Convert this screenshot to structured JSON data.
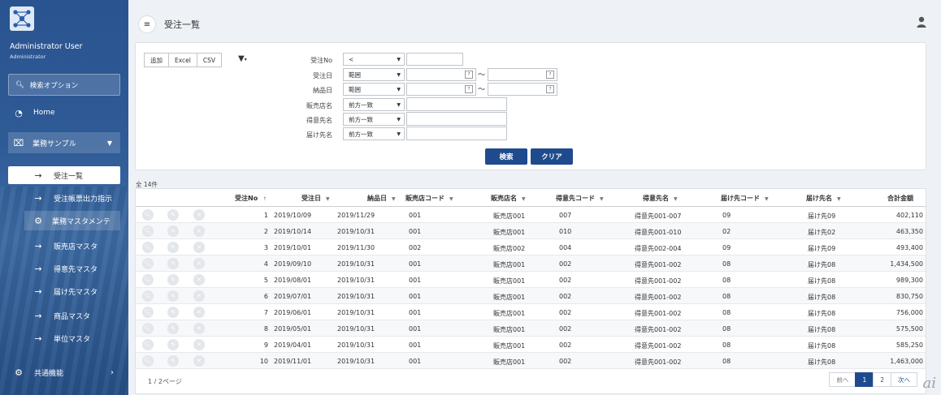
{
  "sidebar": {
    "user_name": "Administrator User",
    "user_role": "Administrator",
    "search_label": "検索オプション",
    "home": "Home",
    "group_business": "業務サンプル",
    "items": [
      {
        "label": "受注一覧",
        "active": true
      },
      {
        "label": "受注帳票出力指示"
      }
    ],
    "subgroup_master": "業務マスタメンテ",
    "master_items": [
      "販売店マスタ",
      "得意先マスタ",
      "届け先マスタ",
      "商品マスタ",
      "単位マスタ"
    ],
    "group_common": "共通機能"
  },
  "header": {
    "title": "受注一覧"
  },
  "toolbar": {
    "add": "追加",
    "excel": "Excel",
    "csv": "CSV"
  },
  "filters": {
    "order_no": {
      "label": "受注No",
      "op": "<",
      "value": ""
    },
    "order_date": {
      "label": "受注日",
      "op": "範囲",
      "from": "",
      "to": ""
    },
    "delivery_date": {
      "label": "納品日",
      "op": "範囲",
      "from": "",
      "to": ""
    },
    "store_name": {
      "label": "販売店名",
      "op": "前方一致",
      "value": ""
    },
    "customer_name": {
      "label": "得意先名",
      "op": "前方一致",
      "value": ""
    },
    "dest_name": {
      "label": "届け先名",
      "op": "前方一致",
      "value": ""
    },
    "tilde": "～",
    "search_button": "検索",
    "clear_button": "クリア"
  },
  "results": {
    "count": "全 14件",
    "columns": [
      "受注No",
      "受注日",
      "納品日",
      "販売店コード",
      "販売店名",
      "得意先コード",
      "得意先名",
      "届け先コード",
      "届け先名",
      "合計金額"
    ],
    "rows": [
      [
        "1",
        "2019/10/09",
        "2019/11/29",
        "001",
        "販売店001",
        "007",
        "得意先001-007",
        "09",
        "届け先09",
        "402,110"
      ],
      [
        "2",
        "2019/10/14",
        "2019/10/31",
        "001",
        "販売店001",
        "010",
        "得意先001-010",
        "02",
        "届け先02",
        "463,350"
      ],
      [
        "3",
        "2019/10/01",
        "2019/11/30",
        "002",
        "販売店002",
        "004",
        "得意先002-004",
        "09",
        "届け先09",
        "493,400"
      ],
      [
        "4",
        "2019/09/10",
        "2019/10/31",
        "001",
        "販売店001",
        "002",
        "得意先001-002",
        "08",
        "届け先08",
        "1,434,500"
      ],
      [
        "5",
        "2019/08/01",
        "2019/10/31",
        "001",
        "販売店001",
        "002",
        "得意先001-002",
        "08",
        "届け先08",
        "989,300"
      ],
      [
        "6",
        "2019/07/01",
        "2019/10/31",
        "001",
        "販売店001",
        "002",
        "得意先001-002",
        "08",
        "届け先08",
        "830,750"
      ],
      [
        "7",
        "2019/06/01",
        "2019/10/31",
        "001",
        "販売店001",
        "002",
        "得意先001-002",
        "08",
        "届け先08",
        "756,000"
      ],
      [
        "8",
        "2019/05/01",
        "2019/10/31",
        "001",
        "販売店001",
        "002",
        "得意先001-002",
        "08",
        "届け先08",
        "575,500"
      ],
      [
        "9",
        "2019/04/01",
        "2019/10/31",
        "001",
        "販売店001",
        "002",
        "得意先001-002",
        "08",
        "届け先08",
        "585,250"
      ],
      [
        "10",
        "2019/11/01",
        "2019/10/31",
        "001",
        "販売店001",
        "002",
        "得意先001-002",
        "08",
        "届け先08",
        "1,463,000"
      ]
    ],
    "page_info": "1 / 2ページ",
    "pager": {
      "prev": "前へ",
      "page1": "1",
      "page2": "2",
      "next": "次へ"
    }
  },
  "watermark": "ai",
  "colors": {
    "primary": "#1f4b8e",
    "sidebar": "#2e5a96"
  }
}
